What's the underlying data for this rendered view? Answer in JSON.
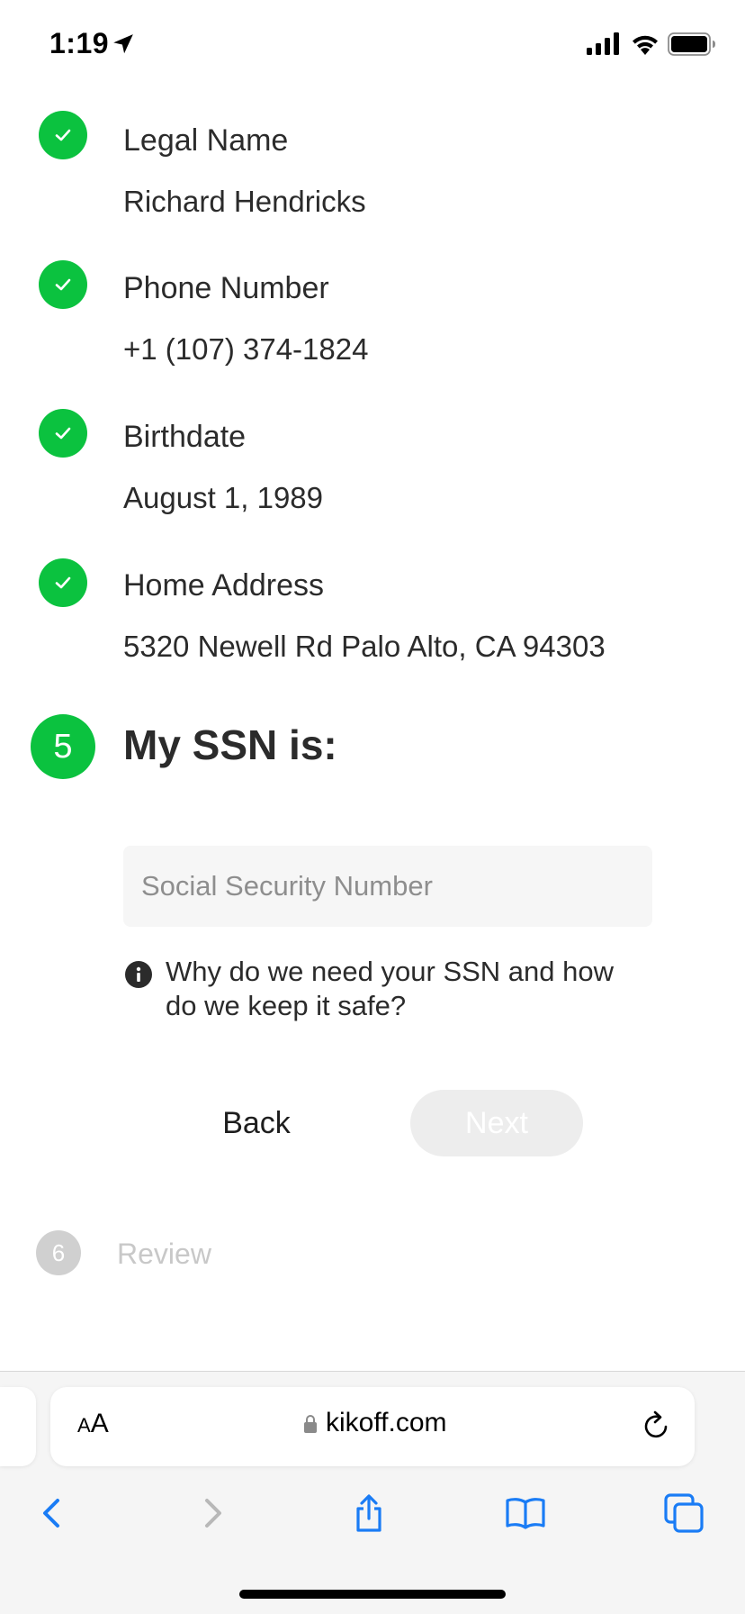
{
  "status_bar": {
    "time": "1:19",
    "icons": [
      "location-arrow-icon",
      "cellular-signal-icon",
      "wifi-icon",
      "battery-icon"
    ]
  },
  "completed_steps": [
    {
      "title": "Legal Name",
      "value": "Richard Hendricks"
    },
    {
      "title": "Phone Number",
      "value": "+1 (107) 374-1824"
    },
    {
      "title": "Birthdate",
      "value": "August 1, 1989"
    },
    {
      "title": "Home Address",
      "value": "5320 Newell Rd Palo Alto, CA 94303"
    }
  ],
  "active_step": {
    "number": "5",
    "title": "My SSN is:",
    "input_placeholder": "Social Security Number",
    "input_value": "",
    "info_text": "Why do we need your SSN and how do we keep it safe?",
    "back_label": "Back",
    "next_label": "Next"
  },
  "pending_step": {
    "number": "6",
    "label": "Review"
  },
  "browser": {
    "text_size_small": "A",
    "text_size_large": "A",
    "url": "kikoff.com"
  },
  "colors": {
    "accent_green": "#0bc23f",
    "text_dark": "#2b2b2b",
    "disabled_gray": "#ededed",
    "pending_gray": "#d0d0d0",
    "ios_blue": "#1a7cf5"
  }
}
